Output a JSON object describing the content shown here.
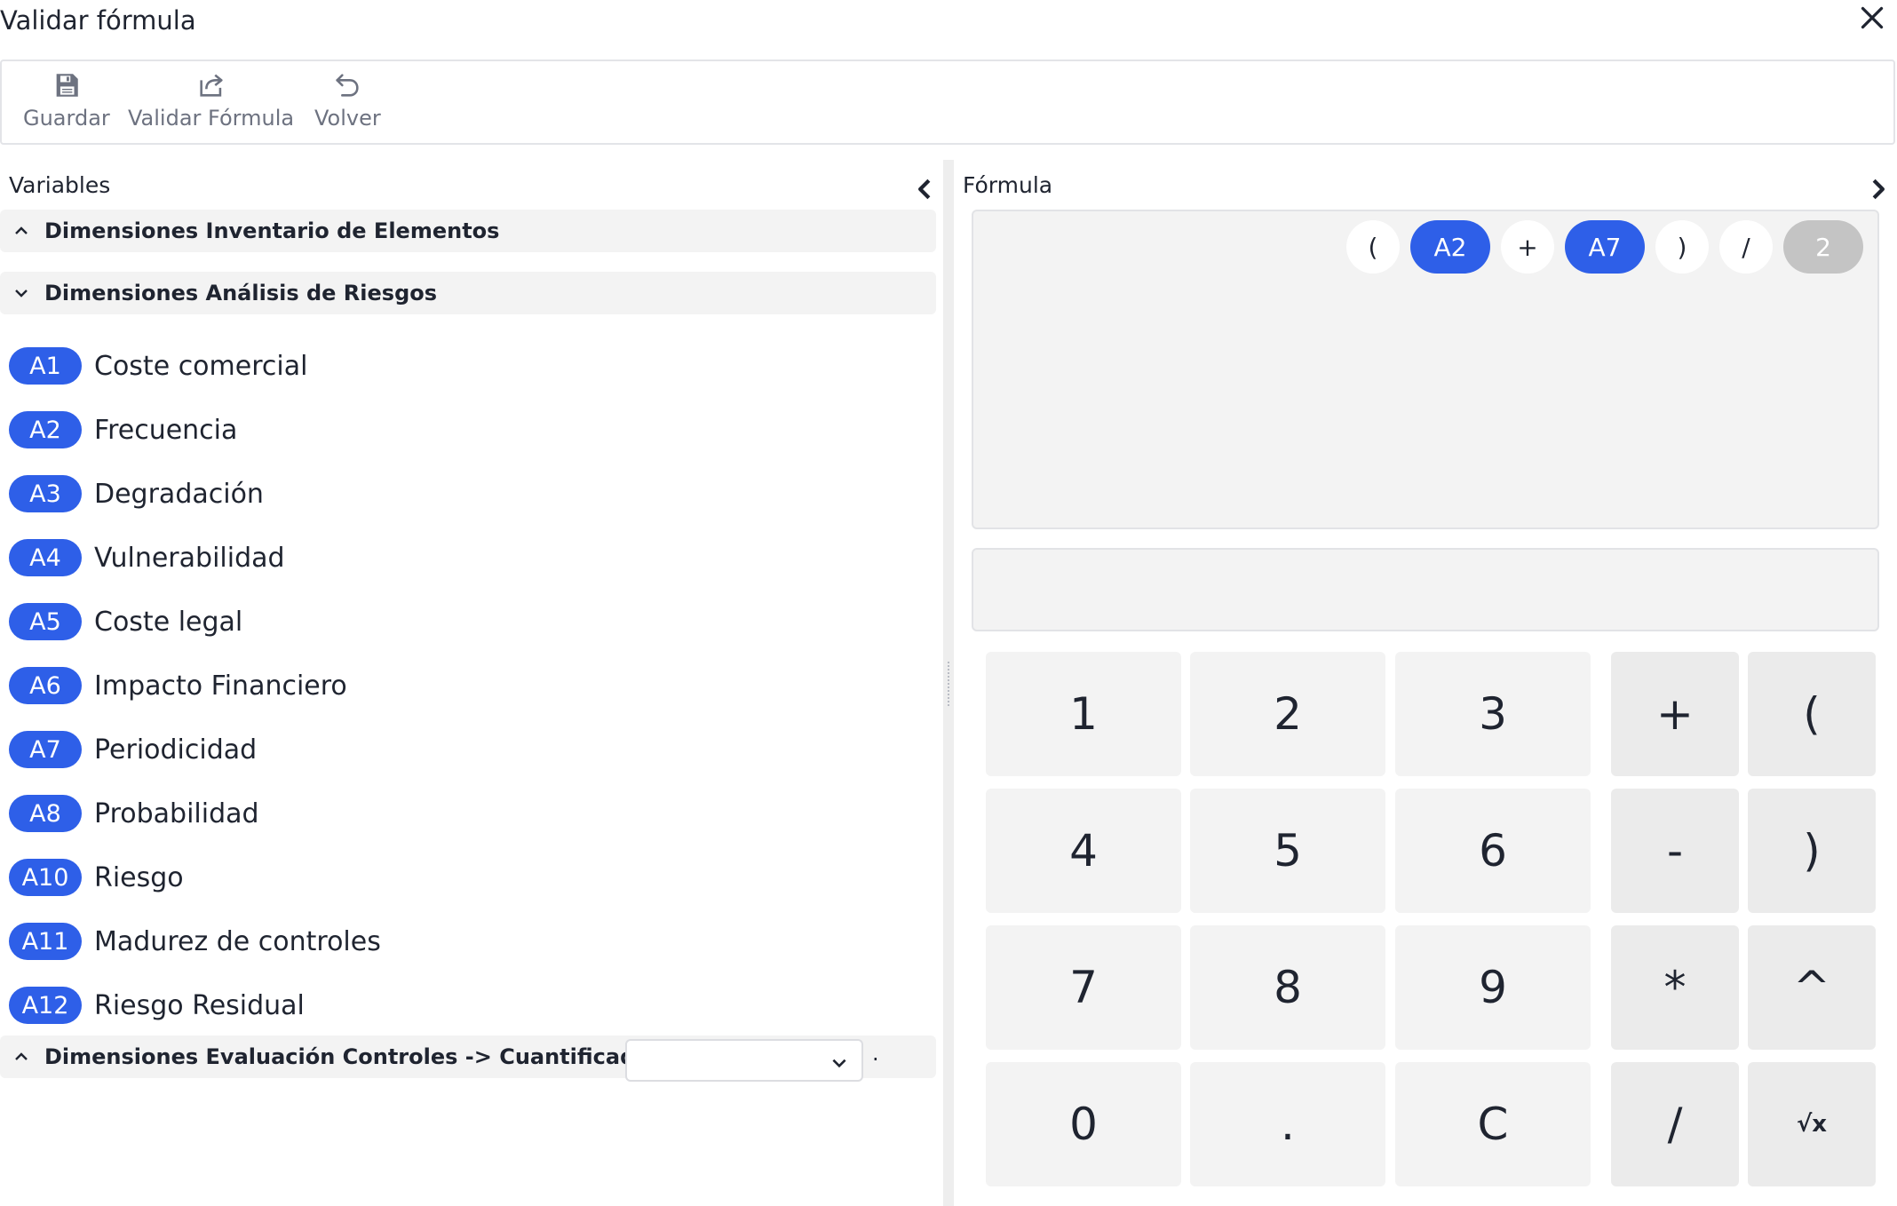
{
  "window": {
    "title": "Validar fórmula"
  },
  "toolbar": {
    "save_label": "Guardar",
    "validate_label": "Validar Fórmula",
    "back_label": "Volver"
  },
  "variables": {
    "heading": "Variables",
    "groups": [
      {
        "label": "Dimensiones Inventario de Elementos",
        "expanded": false
      },
      {
        "label": "Dimensiones Análisis de Riesgos",
        "expanded": true
      },
      {
        "label": "Dimensiones Evaluación Controles -> Cuantificador:",
        "expanded": false
      }
    ],
    "items": [
      {
        "code": "A1",
        "name": "Coste comercial"
      },
      {
        "code": "A2",
        "name": "Frecuencia"
      },
      {
        "code": "A3",
        "name": "Degradación"
      },
      {
        "code": "A4",
        "name": "Vulnerabilidad"
      },
      {
        "code": "A5",
        "name": "Coste legal"
      },
      {
        "code": "A6",
        "name": "Impacto Financiero"
      },
      {
        "code": "A7",
        "name": "Periodicidad"
      },
      {
        "code": "A8",
        "name": "Probabilidad"
      },
      {
        "code": "A10",
        "name": "Riesgo"
      },
      {
        "code": "A11",
        "name": "Madurez de controles"
      },
      {
        "code": "A12",
        "name": "Riesgo Residual"
      }
    ],
    "quantifier_value": "",
    "quantifier_suffix": "."
  },
  "formula": {
    "heading": "Fórmula",
    "tokens": [
      {
        "text": "(",
        "kind": "plain"
      },
      {
        "text": "A2",
        "kind": "var"
      },
      {
        "text": "+",
        "kind": "plain"
      },
      {
        "text": "A7",
        "kind": "var"
      },
      {
        "text": ")",
        "kind": "plain"
      },
      {
        "text": "/",
        "kind": "plain"
      },
      {
        "text": "2",
        "kind": "num"
      }
    ],
    "result": ""
  },
  "keypad": {
    "digits": [
      "1",
      "2",
      "3",
      "4",
      "5",
      "6",
      "7",
      "8",
      "9",
      "0",
      ".",
      "C"
    ],
    "operators": [
      "+",
      "(",
      "-",
      ")",
      "*",
      "^",
      "/",
      "√x"
    ]
  },
  "colors": {
    "accent": "#2e5fe8",
    "panel_bg": "#f3f3f3"
  }
}
